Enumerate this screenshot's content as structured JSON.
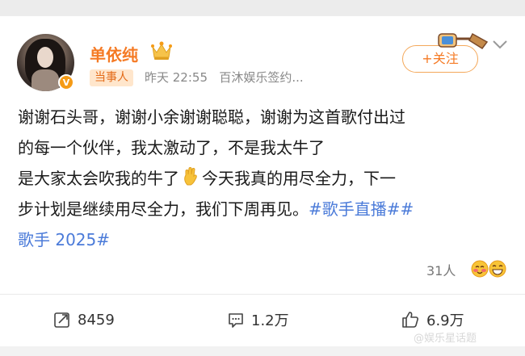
{
  "post": {
    "author": {
      "name": "单依纯",
      "role_tag": "当事人",
      "verified_icon": "verified-v-icon",
      "crown_icon": "crown-icon"
    },
    "meta": {
      "time": "昨天 22:55",
      "source": "百沐娱乐签约..."
    },
    "follow_label": "+关注",
    "lines": [
      "谢谢石头哥，谢谢小余谢谢聪聪，谢谢为这首歌付出过",
      "的每一个伙伴，我太激动了，不是我太牛了",
      "是大家太会吹我的牛了",
      "今天我真的用尽全力，下一",
      "步计划是继续用尽全力，我们下周再见。",
      "#歌手直播##",
      "歌手 2025#"
    ],
    "likers_count": "31人",
    "actions": {
      "repost": "8459",
      "comment": "1.2万",
      "like": "6.9万"
    }
  },
  "watermark": "@娱乐星话题",
  "colors": {
    "accent": "#f57a24",
    "hashtag": "#4b7bd9",
    "tag_bg": "#ffe6cc"
  }
}
